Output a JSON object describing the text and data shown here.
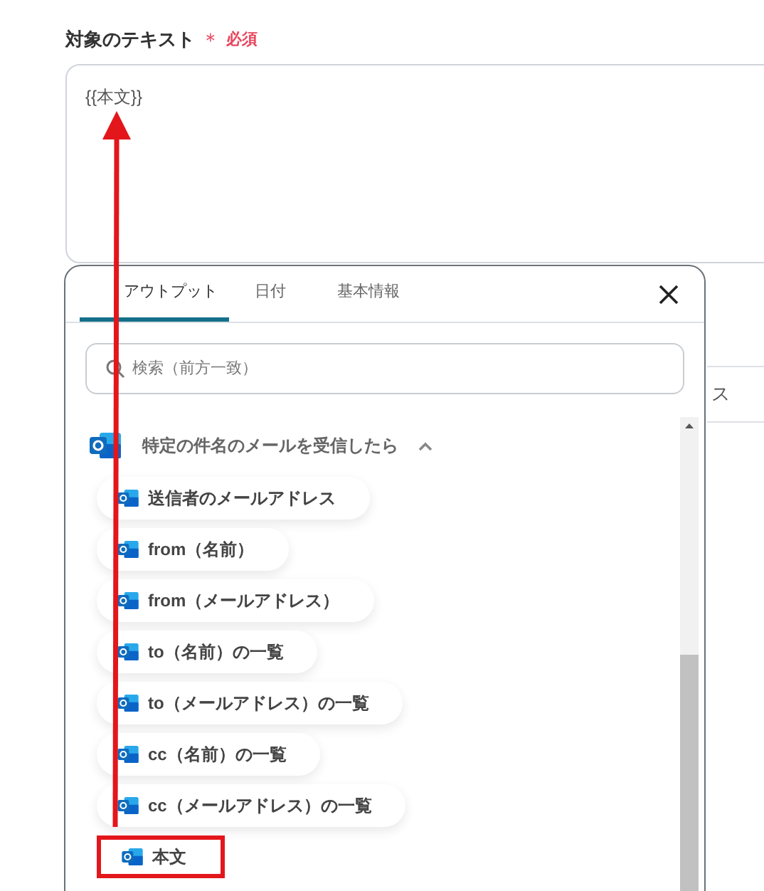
{
  "field": {
    "label": "対象のテキスト",
    "required_mark": "＊",
    "required_text": "必須",
    "value": "{{本文}}"
  },
  "background_field": {
    "text": "ス"
  },
  "popup": {
    "tabs": [
      {
        "label": "アウトプット",
        "selected": true
      },
      {
        "label": "日付",
        "selected": false
      },
      {
        "label": "基本情報",
        "selected": false
      }
    ],
    "search": {
      "placeholder": "検索（前方一致）"
    },
    "group": {
      "title": "特定の件名のメールを受信したら",
      "expanded": true,
      "items": [
        {
          "label": "送信者のメールアドレス",
          "highlighted": false
        },
        {
          "label": "from（名前）",
          "highlighted": false
        },
        {
          "label": "from（メールアドレス）",
          "highlighted": false
        },
        {
          "label": "to（名前）の一覧",
          "highlighted": false
        },
        {
          "label": "to（メールアドレス）の一覧",
          "highlighted": false
        },
        {
          "label": "cc（名前）の一覧",
          "highlighted": false
        },
        {
          "label": "cc（メールアドレス）の一覧",
          "highlighted": false
        },
        {
          "label": "本文",
          "highlighted": true
        }
      ]
    }
  }
}
